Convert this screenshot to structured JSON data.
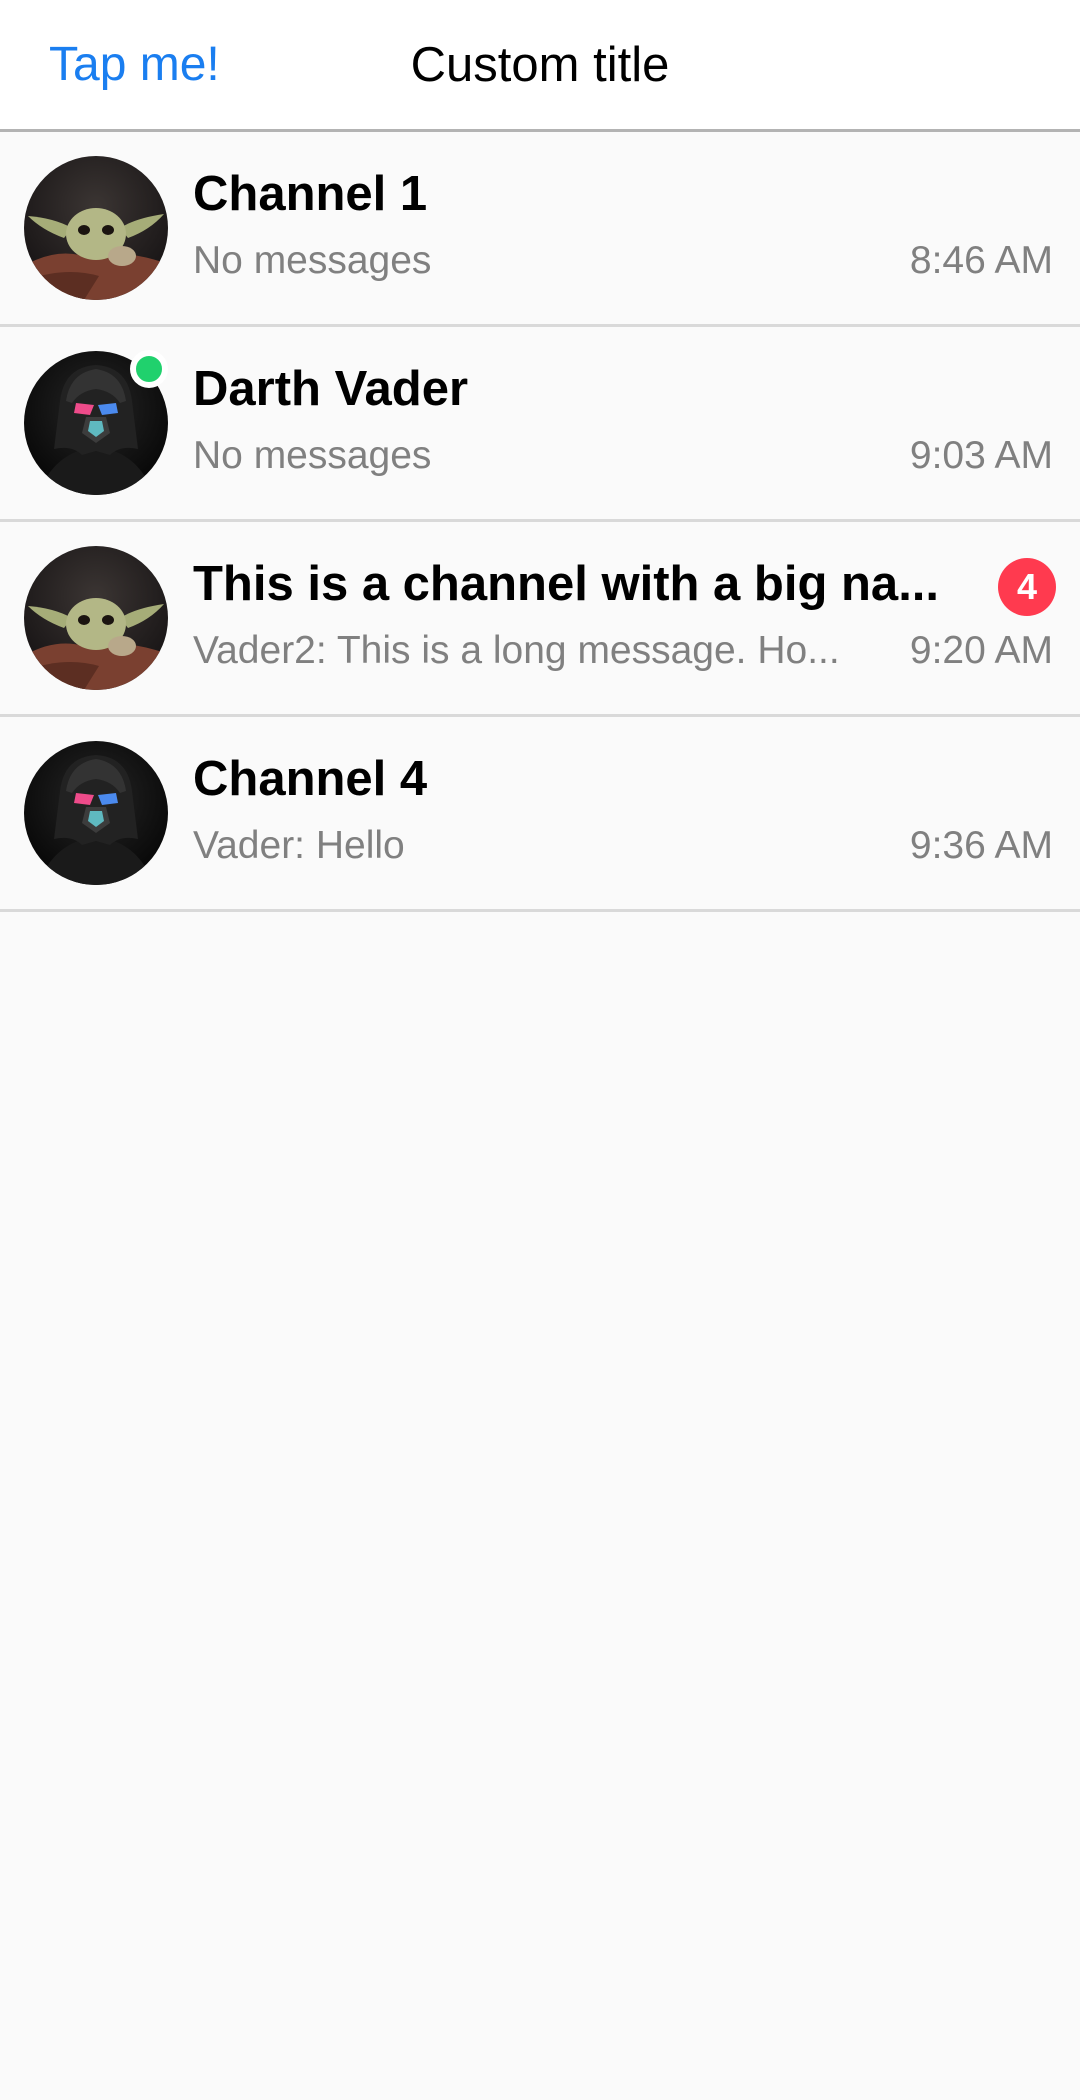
{
  "nav": {
    "left_button": "Tap me!",
    "title": "Custom title"
  },
  "channels": [
    {
      "name": "Channel 1",
      "preview": "No messages",
      "time": "8:46 AM",
      "avatar": "baby-yoda-avatar",
      "online": false,
      "unread": null
    },
    {
      "name": "Darth Vader",
      "preview": "No messages",
      "time": "9:03 AM",
      "avatar": "darth-vader-avatar",
      "online": true,
      "unread": null
    },
    {
      "name": "This is a channel with a big na...",
      "preview": "Vader2: This is a long message. Ho...",
      "time": "9:20 AM",
      "avatar": "baby-yoda-avatar",
      "online": false,
      "unread": "4"
    },
    {
      "name": "Channel 4",
      "preview": "Vader: Hello",
      "time": "9:36 AM",
      "avatar": "darth-vader-avatar",
      "online": false,
      "unread": null
    }
  ],
  "colors": {
    "accent": "#1a7ef0",
    "online": "#20d16d",
    "badge": "#ff3a4f",
    "secondary_text": "#808080"
  }
}
